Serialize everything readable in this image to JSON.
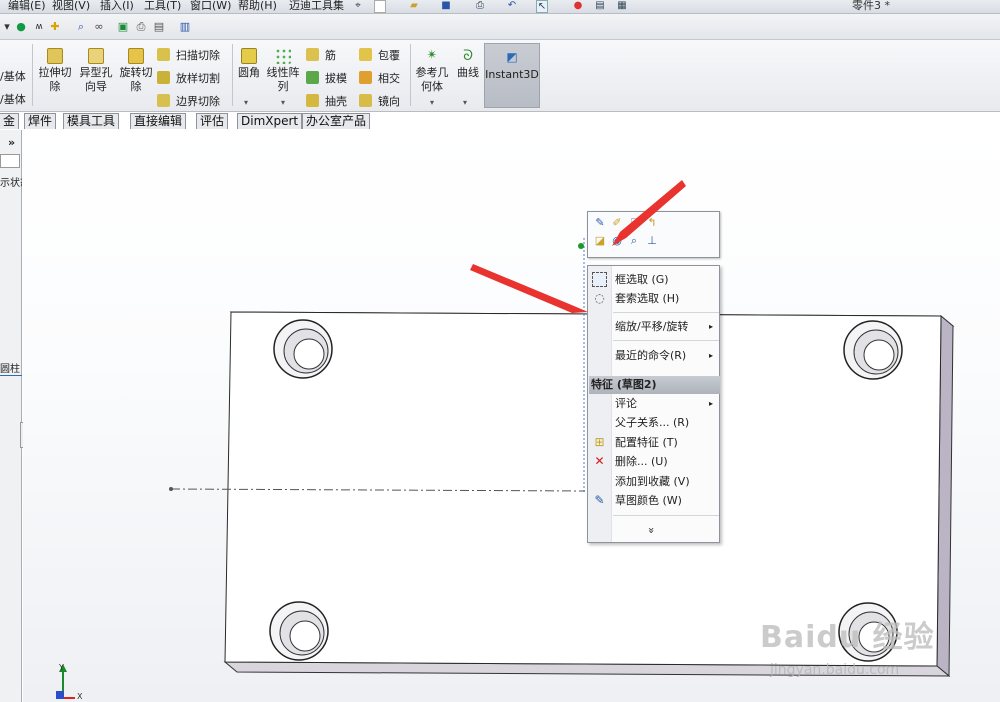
{
  "menubar": {
    "items": [
      "编辑(E)",
      "视图(V)",
      "插入(I)",
      "工具(T)",
      "窗口(W)",
      "帮助(H)",
      "迈迪工具集"
    ],
    "document_title": "零件3 *"
  },
  "ribbon": {
    "cut_extrude": "拉伸切除",
    "hole_wizard": "异型孔向导",
    "revolve_cut": "旋转切除",
    "sweep_cut": "扫描切除",
    "loft_cut": "放样切割",
    "boundary_cut": "边界切除",
    "fillet": "圆角",
    "linear_pattern": "线性阵列",
    "rib": "筋",
    "draft": "拔模",
    "shell": "抽壳",
    "wrap": "包覆",
    "intersect": "相交",
    "mirror": "镜向",
    "ref_geometry": "参考几何体",
    "curves": "曲线",
    "instant3d": "Instant3D",
    "left_label_1": "/基体",
    "left_label_2": "/基体"
  },
  "tabs": [
    "金",
    "焊件",
    "模具工具",
    "直接编辑",
    "评估",
    "DimXpert",
    "办公室产品"
  ],
  "leftpane": {
    "text_1": "示状态",
    "text_2": "圆柱"
  },
  "context_menu": {
    "box_select": "框选取 (G)",
    "lasso_select": "套索选取 (H)",
    "zoom_pan_rotate": "缩放/平移/旋转",
    "recent_commands": "最近的命令(R)",
    "section_header": "特征 (草图2)",
    "comment": "评论",
    "parent_child": "父子关系... (R)",
    "configure_feature": "配置特征 (T)",
    "delete": "删除... (U)",
    "add_to_favorites": "添加到收藏 (V)",
    "sketch_color": "草图颜色 (W)",
    "more": "»"
  },
  "triad": {
    "y": "Y",
    "x": "X"
  },
  "watermark": {
    "main": "Baidu 经验",
    "sub": "jingyan.baidu.com"
  },
  "colors": {
    "arrow": "#e8332f",
    "part_face": "#ffffff",
    "part_edge": "#2a2a2a",
    "menu_header": "#b7bcc4",
    "delete_icon": "#d11a1a"
  }
}
